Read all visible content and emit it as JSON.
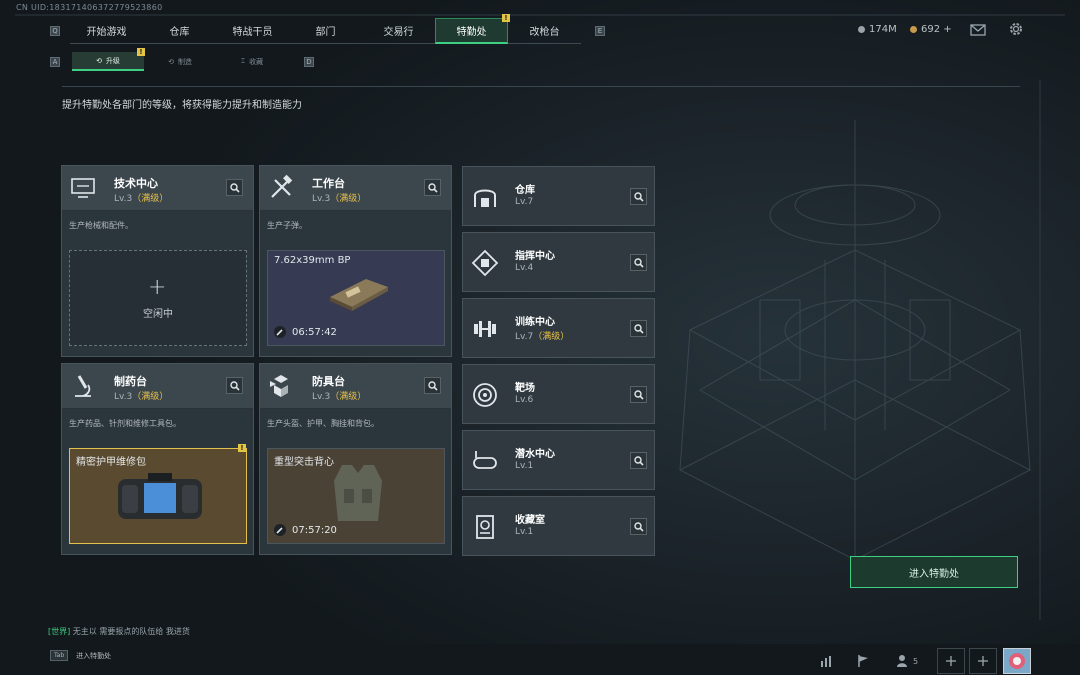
{
  "uid": "CN UID:183171406372779523860",
  "top_nav": {
    "left_key": "Q",
    "right_key": "E",
    "tabs": [
      {
        "label": "开始游戏",
        "active": false
      },
      {
        "label": "仓库",
        "active": false
      },
      {
        "label": "特战干员",
        "active": false
      },
      {
        "label": "部门",
        "active": false
      },
      {
        "label": "交易行",
        "active": false
      },
      {
        "label": "特勤处",
        "active": true
      },
      {
        "label": "改枪台",
        "active": false
      }
    ],
    "active_badge": "!"
  },
  "resources": {
    "currency_a": "174M",
    "currency_b": "692 +"
  },
  "sub_tabs": {
    "left_key": "A",
    "right_key": "D",
    "tabs": [
      {
        "label": "升级",
        "active": true
      },
      {
        "label": "制造",
        "active": false
      },
      {
        "label": "收藏",
        "active": false
      }
    ],
    "badge": "!"
  },
  "description": "提升特勤处各部门的等级，将获得能力提升和制造能力",
  "departments": {
    "tech": {
      "name": "技术中心",
      "lv": "Lv.3",
      "max": "（满级）",
      "sub": "生产枪械和配件。",
      "slot_plus": "+",
      "slot_label": "空闲中"
    },
    "workbench": {
      "name": "工作台",
      "lv": "Lv.3",
      "max": "（满级）",
      "sub": "生产子弹。",
      "item": "7.62x39mm BP",
      "timer": "06:57:42"
    },
    "pharmacy": {
      "name": "制药台",
      "lv": "Lv.3",
      "max": "（满级）",
      "sub": "生产药品、针剂和维修工具包。",
      "item": "精密护甲维修包",
      "badge": "!"
    },
    "armor": {
      "name": "防具台",
      "lv": "Lv.3",
      "max": "（满级）",
      "sub": "生产头盔、护甲、胸挂和背包。",
      "item": "重型突击背心",
      "timer": "07:57:20"
    }
  },
  "right_list": [
    {
      "name": "仓库",
      "lv": "Lv.7",
      "max": ""
    },
    {
      "name": "指挥中心",
      "lv": "Lv.4",
      "max": ""
    },
    {
      "name": "训练中心",
      "lv": "Lv.7",
      "max": "（满级）"
    },
    {
      "name": "靶场",
      "lv": "Lv.6",
      "max": ""
    },
    {
      "name": "潜水中心",
      "lv": "Lv.1",
      "max": ""
    },
    {
      "name": "收藏室",
      "lv": "Lv.1",
      "max": ""
    }
  ],
  "enter_button": "进入特勤处",
  "chat": {
    "channel": "[世界]",
    "user": "无主以",
    "message": "需要报点的队伍给 我进货"
  },
  "bottom": {
    "tab_key": "Tab",
    "tab_label": "进入特勤处",
    "friends_count": "5"
  },
  "colors": {
    "accent": "#3ecf82",
    "max_level": "#e8c14a",
    "badge": "#e3c545"
  },
  "icons": [
    "settings-icon",
    "mail-icon",
    "search-icon",
    "wrench-icon",
    "stats-icon",
    "flag-icon",
    "friends-icon",
    "add-icon"
  ]
}
